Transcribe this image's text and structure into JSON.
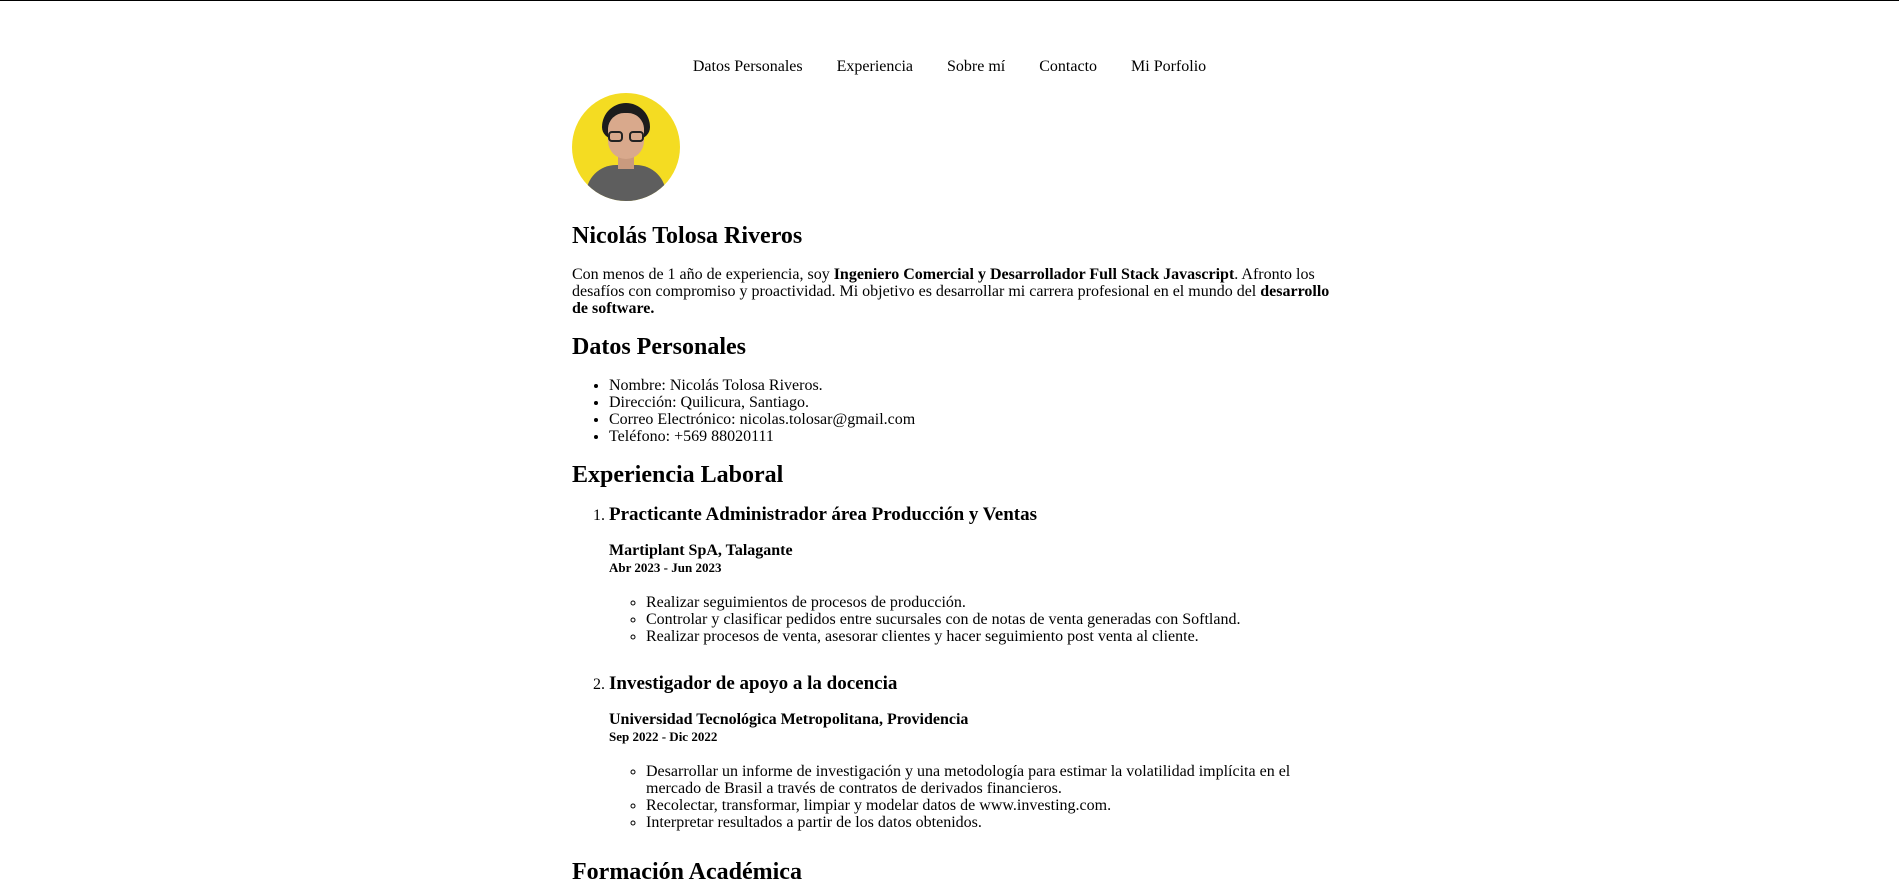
{
  "nav": [
    {
      "label": "Datos Personales"
    },
    {
      "label": "Experiencia"
    },
    {
      "label": "Sobre mí"
    },
    {
      "label": "Contacto"
    },
    {
      "label": "Mi Porfolio"
    }
  ],
  "profile": {
    "name": "Nicolás Tolosa Riveros",
    "intro_1": "Con menos de 1 año de experiencia, soy ",
    "intro_bold_1": "Ingeniero Comercial y Desarrollador Full Stack Javascript",
    "intro_2": ". Afronto los desafíos con compromiso y proactividad. Mi objetivo es desarrollar mi carrera profesional en el mundo del ",
    "intro_bold_2": "desarrollo de software."
  },
  "personal": {
    "heading": "Datos Personales",
    "items": [
      "Nombre: Nicolás Tolosa Riveros.",
      "Dirección: Quilicura, Santiago.",
      "Correo Electrónico: nicolas.tolosar@gmail.com",
      "Teléfono: +569 88020111"
    ]
  },
  "experience": {
    "heading": "Experiencia Laboral",
    "jobs": [
      {
        "title": "Practicante Administrador área Producción y Ventas",
        "company": "Martiplant SpA, Talagante",
        "period": "Abr 2023 - Jun 2023",
        "tasks": [
          "Realizar seguimientos de procesos de producción.",
          "Controlar y clasificar pedidos entre sucursales con de notas de venta generadas con Softland.",
          "Realizar procesos de venta, asesorar clientes y hacer seguimiento post venta al cliente."
        ]
      },
      {
        "title": "Investigador de apoyo a la docencia",
        "company": "Universidad Tecnológica Metropolitana, Providencia",
        "period": "Sep 2022 - Dic 2022",
        "tasks": [
          "Desarrollar un informe de investigación y una metodología para estimar la volatilidad implícita en el mercado de Brasil a través de contratos de derivados financieros.",
          "Recolectar, transformar, limpiar y modelar datos de www.investing.com.",
          "Interpretar resultados a partir de los datos obtenidos."
        ]
      }
    ]
  },
  "next_section": {
    "heading": "Formación Académica"
  }
}
